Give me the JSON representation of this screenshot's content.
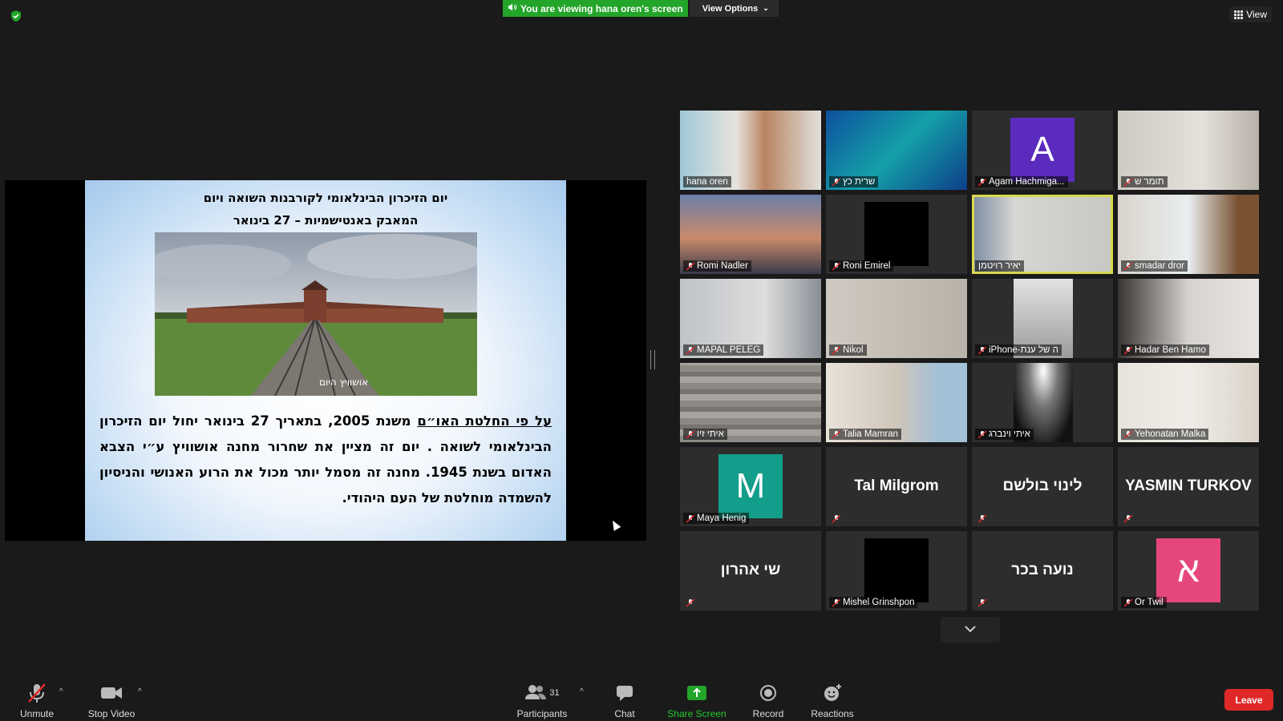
{
  "banner": {
    "viewing_text": "You are viewing hana oren's screen",
    "view_options_label": "View Options"
  },
  "view_button_label": "View",
  "slide": {
    "title_line1": "יום הזיכרון הבינלאומי לקורבנות השואה ויום",
    "title_line2": "המאבק באנטישמיות – 27 בינואר",
    "photo_caption": "אושוויץ היום",
    "body_underlined": "על פי החלטת האו״ם",
    "body_rest": " משנת 2005, בתאריך 27 בינואר יחול יום הזיכרון הבינלאומי לשואה . יום זה מציין את שחרור מחנה אושוויץ ע״י הצבא האדום בשנת 1945. מחנה זה מסמל יותר מכול את הרוע האנושי והניסיון להשמדה מוחלטת של העם היהודי."
  },
  "participants_tiles": [
    {
      "name": "hana oren",
      "muted": false
    },
    {
      "name": "שרית כץ",
      "muted": true
    },
    {
      "name": "Agam Hachmiga...",
      "muted": true,
      "avatar_letter": "A"
    },
    {
      "name": "תומר ש",
      "muted": true
    },
    {
      "name": "Romi Nadler",
      "muted": true
    },
    {
      "name": "Roni Emirel",
      "muted": true
    },
    {
      "name": "יאיר רויטמן",
      "muted": false
    },
    {
      "name": "smadar dror",
      "muted": true
    },
    {
      "name": "MAPAL PELEG",
      "muted": true
    },
    {
      "name": "Nikol",
      "muted": true
    },
    {
      "name": "iPhone-ה של ענת",
      "muted": true
    },
    {
      "name": "Hadar Ben Hamo",
      "muted": true
    },
    {
      "name": "איתי זיו",
      "muted": true
    },
    {
      "name": "Talia Mamran",
      "muted": true
    },
    {
      "name": "איתי וינברג",
      "muted": true
    },
    {
      "name": "Yehonatan Malka",
      "muted": true
    },
    {
      "name": "Maya Henig",
      "muted": true,
      "avatar_letter": "M"
    },
    {
      "name": "",
      "muted": true,
      "big_name": "Tal Milgrom"
    },
    {
      "name": "",
      "muted": true,
      "big_name": "לינוי בולשם"
    },
    {
      "name": "",
      "muted": true,
      "big_name": "YASMIN TURKOV"
    },
    {
      "name": "",
      "muted": true,
      "big_name": "שי אהרון"
    },
    {
      "name": "Mishel Grinshpon",
      "muted": true
    },
    {
      "name": "",
      "muted": true,
      "big_name": "נועה בכר"
    },
    {
      "name": "Or Twil",
      "muted": true,
      "avatar_letter": "א"
    }
  ],
  "toolbar": {
    "unmute": "Unmute",
    "stop_video": "Stop Video",
    "participants": "Participants",
    "participants_count": "31",
    "chat": "Chat",
    "share_screen": "Share Screen",
    "record": "Record",
    "reactions": "Reactions",
    "leave": "Leave"
  },
  "colors": {
    "share_green": "#23a52a",
    "leave_red": "#e02828",
    "active_speaker": "#d7d94e"
  }
}
